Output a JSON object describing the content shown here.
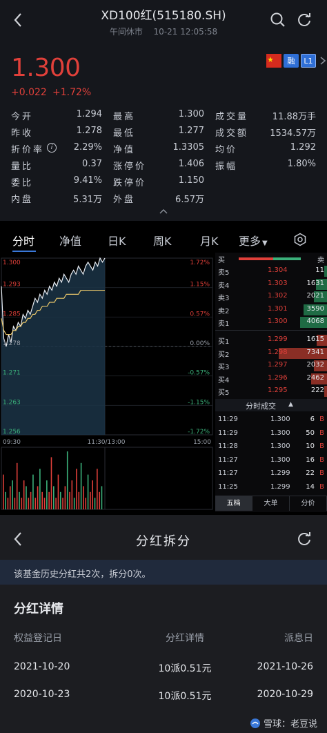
{
  "header": {
    "title": "XD100红(515180.SH)",
    "status": "午间休市",
    "datetime": "10-21 12:05:58"
  },
  "quote": {
    "price": "1.300",
    "change": "+0.022",
    "change_pct": "+1.72%",
    "badges": [
      "融",
      "L1"
    ],
    "rows": [
      [
        [
          "今开",
          "1.294"
        ],
        [
          "最高",
          "1.300"
        ],
        [
          "成交量",
          "11.88万手"
        ]
      ],
      [
        [
          "昨收",
          "1.278"
        ],
        [
          "最低",
          "1.277"
        ],
        [
          "成交额",
          "1534.57万"
        ]
      ],
      [
        [
          "折价率",
          "2.29%"
        ],
        [
          "净值",
          "1.3305"
        ],
        [
          "均价",
          "1.292"
        ]
      ],
      [
        [
          "量比",
          "0.37"
        ],
        [
          "涨停价",
          "1.406"
        ],
        [
          "振幅",
          "1.80%"
        ]
      ],
      [
        [
          "委比",
          "9.41%"
        ],
        [
          "跌停价",
          "1.150"
        ]
      ],
      [
        [
          "内盘",
          "5.31万"
        ],
        [
          "外盘",
          "6.57万"
        ]
      ]
    ]
  },
  "tabs": [
    "分时",
    "净值",
    "日K",
    "周K",
    "月K",
    "更多"
  ],
  "chart_data": {
    "type": "line",
    "y_left_ticks": [
      "1.300",
      "1.293",
      "1.285",
      "1.278",
      "1.271",
      "1.263",
      "1.256"
    ],
    "y_right_ticks": [
      "1.72%",
      "1.15%",
      "0.57%",
      "0.00%",
      "-0.57%",
      "-1.15%",
      "-1.72%"
    ],
    "x_ticks": [
      "09:30",
      "11:30/13:00",
      "15:00"
    ],
    "ylim": [
      1.256,
      1.3
    ],
    "prev_close": 1.278,
    "series": [
      {
        "values": [
          1.293,
          1.28,
          1.278,
          1.281,
          1.279,
          1.283,
          1.282,
          1.284,
          1.283,
          1.286,
          1.285,
          1.287,
          1.286,
          1.288,
          1.29,
          1.289,
          1.291,
          1.29,
          1.292,
          1.291,
          1.293,
          1.292,
          1.294,
          1.293,
          1.295,
          1.294,
          1.296,
          1.295,
          1.294,
          1.296,
          1.297,
          1.296,
          1.298,
          1.297,
          1.296,
          1.298,
          1.299,
          1.298,
          1.297,
          1.299,
          1.298,
          1.3,
          1.299,
          1.3
        ]
      },
      {
        "values": [
          1.285,
          1.282,
          1.281,
          1.281,
          1.281,
          1.282,
          1.282,
          1.283,
          1.283,
          1.284,
          1.284,
          1.285,
          1.285,
          1.286,
          1.286,
          1.287,
          1.287,
          1.288,
          1.288,
          1.288,
          1.289,
          1.289,
          1.289,
          1.29,
          1.29,
          1.29,
          1.29,
          1.291,
          1.291,
          1.291,
          1.291,
          1.291,
          1.291,
          1.292,
          1.292,
          1.292,
          1.292,
          1.292,
          1.292,
          1.292,
          1.292,
          1.292,
          1.292,
          1.292
        ]
      }
    ],
    "volume": [
      6,
      3,
      2,
      4,
      5,
      2,
      8,
      3,
      2,
      5,
      4,
      2,
      3,
      6,
      2,
      4,
      7,
      3,
      2,
      5,
      3,
      9,
      4,
      2,
      6,
      3,
      2,
      4,
      10,
      3,
      5,
      2,
      7,
      3,
      8,
      4,
      2,
      6,
      3,
      5,
      2,
      7,
      3,
      4
    ]
  },
  "book": {
    "buy_label": "买",
    "sell_label": "卖",
    "asks": [
      [
        "卖5",
        "1.304",
        "11"
      ],
      [
        "卖4",
        "1.303",
        "1631"
      ],
      [
        "卖3",
        "1.302",
        "2021"
      ],
      [
        "卖2",
        "1.301",
        "3590"
      ],
      [
        "卖1",
        "1.300",
        "4068"
      ]
    ],
    "bids": [
      [
        "买1",
        "1.299",
        "1615"
      ],
      [
        "买2",
        "1.298",
        "7341"
      ],
      [
        "买3",
        "1.297",
        "2032"
      ],
      [
        "买4",
        "1.296",
        "2462"
      ],
      [
        "买5",
        "1.295",
        "222"
      ]
    ],
    "trades_label": "分时成交",
    "trades": [
      [
        "11:29",
        "1.300",
        "6",
        "B"
      ],
      [
        "11:29",
        "1.300",
        "50",
        "B"
      ],
      [
        "11:28",
        "1.300",
        "10",
        "B"
      ],
      [
        "11:27",
        "1.300",
        "16",
        "B"
      ],
      [
        "11:27",
        "1.299",
        "22",
        "B"
      ],
      [
        "11:25",
        "1.299",
        "14",
        "B"
      ]
    ],
    "bottom_tabs": [
      "五档",
      "大单",
      "分价"
    ]
  },
  "dividend": {
    "title": "分红拆分",
    "notice": "该基金历史分红共2次，拆分0次。",
    "section_title": "分红详情",
    "columns": [
      "权益登记日",
      "分红详情",
      "派息日"
    ],
    "rows": [
      [
        "2021-10-20",
        "10派0.51元",
        "2021-10-26"
      ],
      [
        "2020-10-23",
        "10派0.51元",
        "2020-10-29"
      ]
    ],
    "watermark": "雪球：老豆说"
  },
  "colors": {
    "up": "#e0403a",
    "down": "#3bb07a",
    "accent": "#3a78d8"
  }
}
